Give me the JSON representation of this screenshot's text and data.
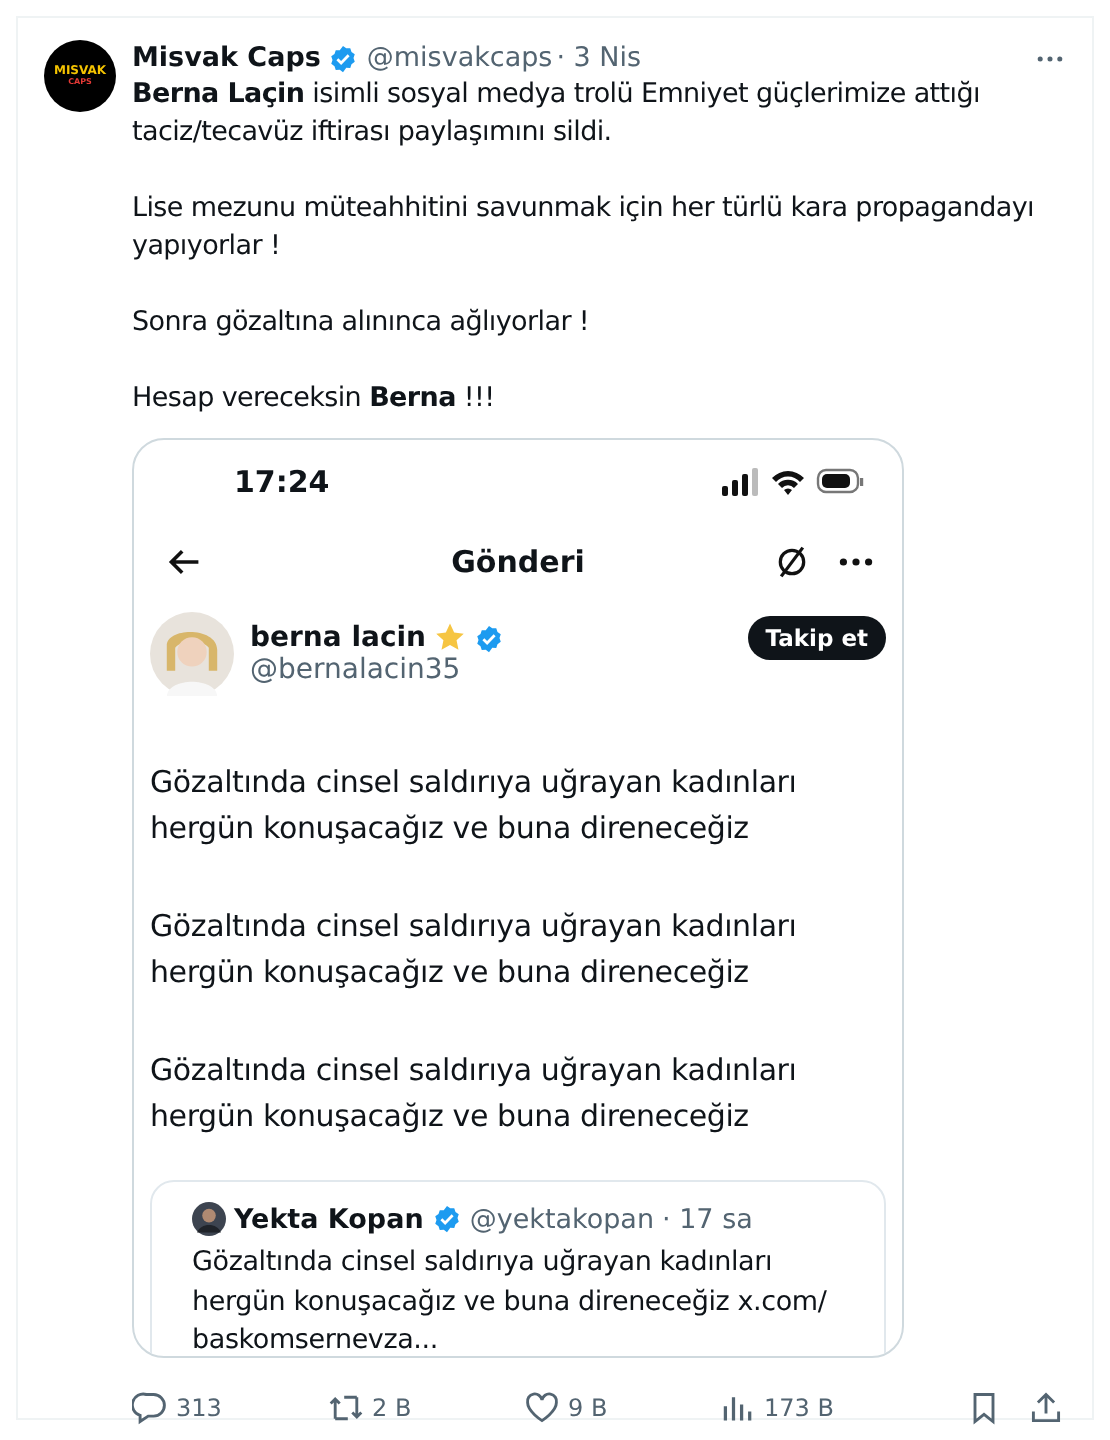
{
  "tweet": {
    "author": {
      "name": "Misvak Caps",
      "handle": "@misvakcaps",
      "time": "· 3 Nis",
      "logo_top": "MISVAK",
      "logo_bottom": "CAPS"
    },
    "paragraphs": [
      "**Berna Laçin** isimli sosyal medya trolü Emniyet güçlerimize attığı taciz/tecavüz iftirası paylaşımını sildi.",
      "Lise mezunu müteahhitini savunmak için her türlü kara propagandayı yapıyorlar !",
      "Sonra gözaltına alınınca ağlıyorlar !",
      "Hesap vereceksin **Berna** !!!"
    ],
    "screenshot": {
      "clock": "17:24",
      "header_title": "Gönderi",
      "user": {
        "name": "berna lacin",
        "handle": "@bernalacin35",
        "follow": "Takip et"
      },
      "paragraphs": [
        "Gözaltında cinsel saldırıya uğrayan kadınları hergün konuşacağız ve buna direneceğiz",
        "Gözaltında cinsel saldırıya uğrayan kadınları hergün konuşacağız ve buna direneceğiz",
        "Gözaltında cinsel saldırıya uğrayan kadınları hergün konuşacağız ve buna direneceğiz"
      ],
      "quote": {
        "name": "Yekta Kopan",
        "handle": "@yektakopan",
        "time": "· 17 sa",
        "text": "Gözaltında cinsel saldırıya uğrayan kadınları hergün konuşacağız ve buna direneceğiz x.com/ baskomsernevza..."
      }
    },
    "actions": [
      {
        "kind": "reply",
        "count": "313"
      },
      {
        "kind": "repost",
        "count": "2 B"
      },
      {
        "kind": "like",
        "count": "9 B"
      },
      {
        "kind": "views",
        "count": "173 B"
      },
      {
        "kind": "bookmark"
      },
      {
        "kind": "share"
      }
    ]
  }
}
